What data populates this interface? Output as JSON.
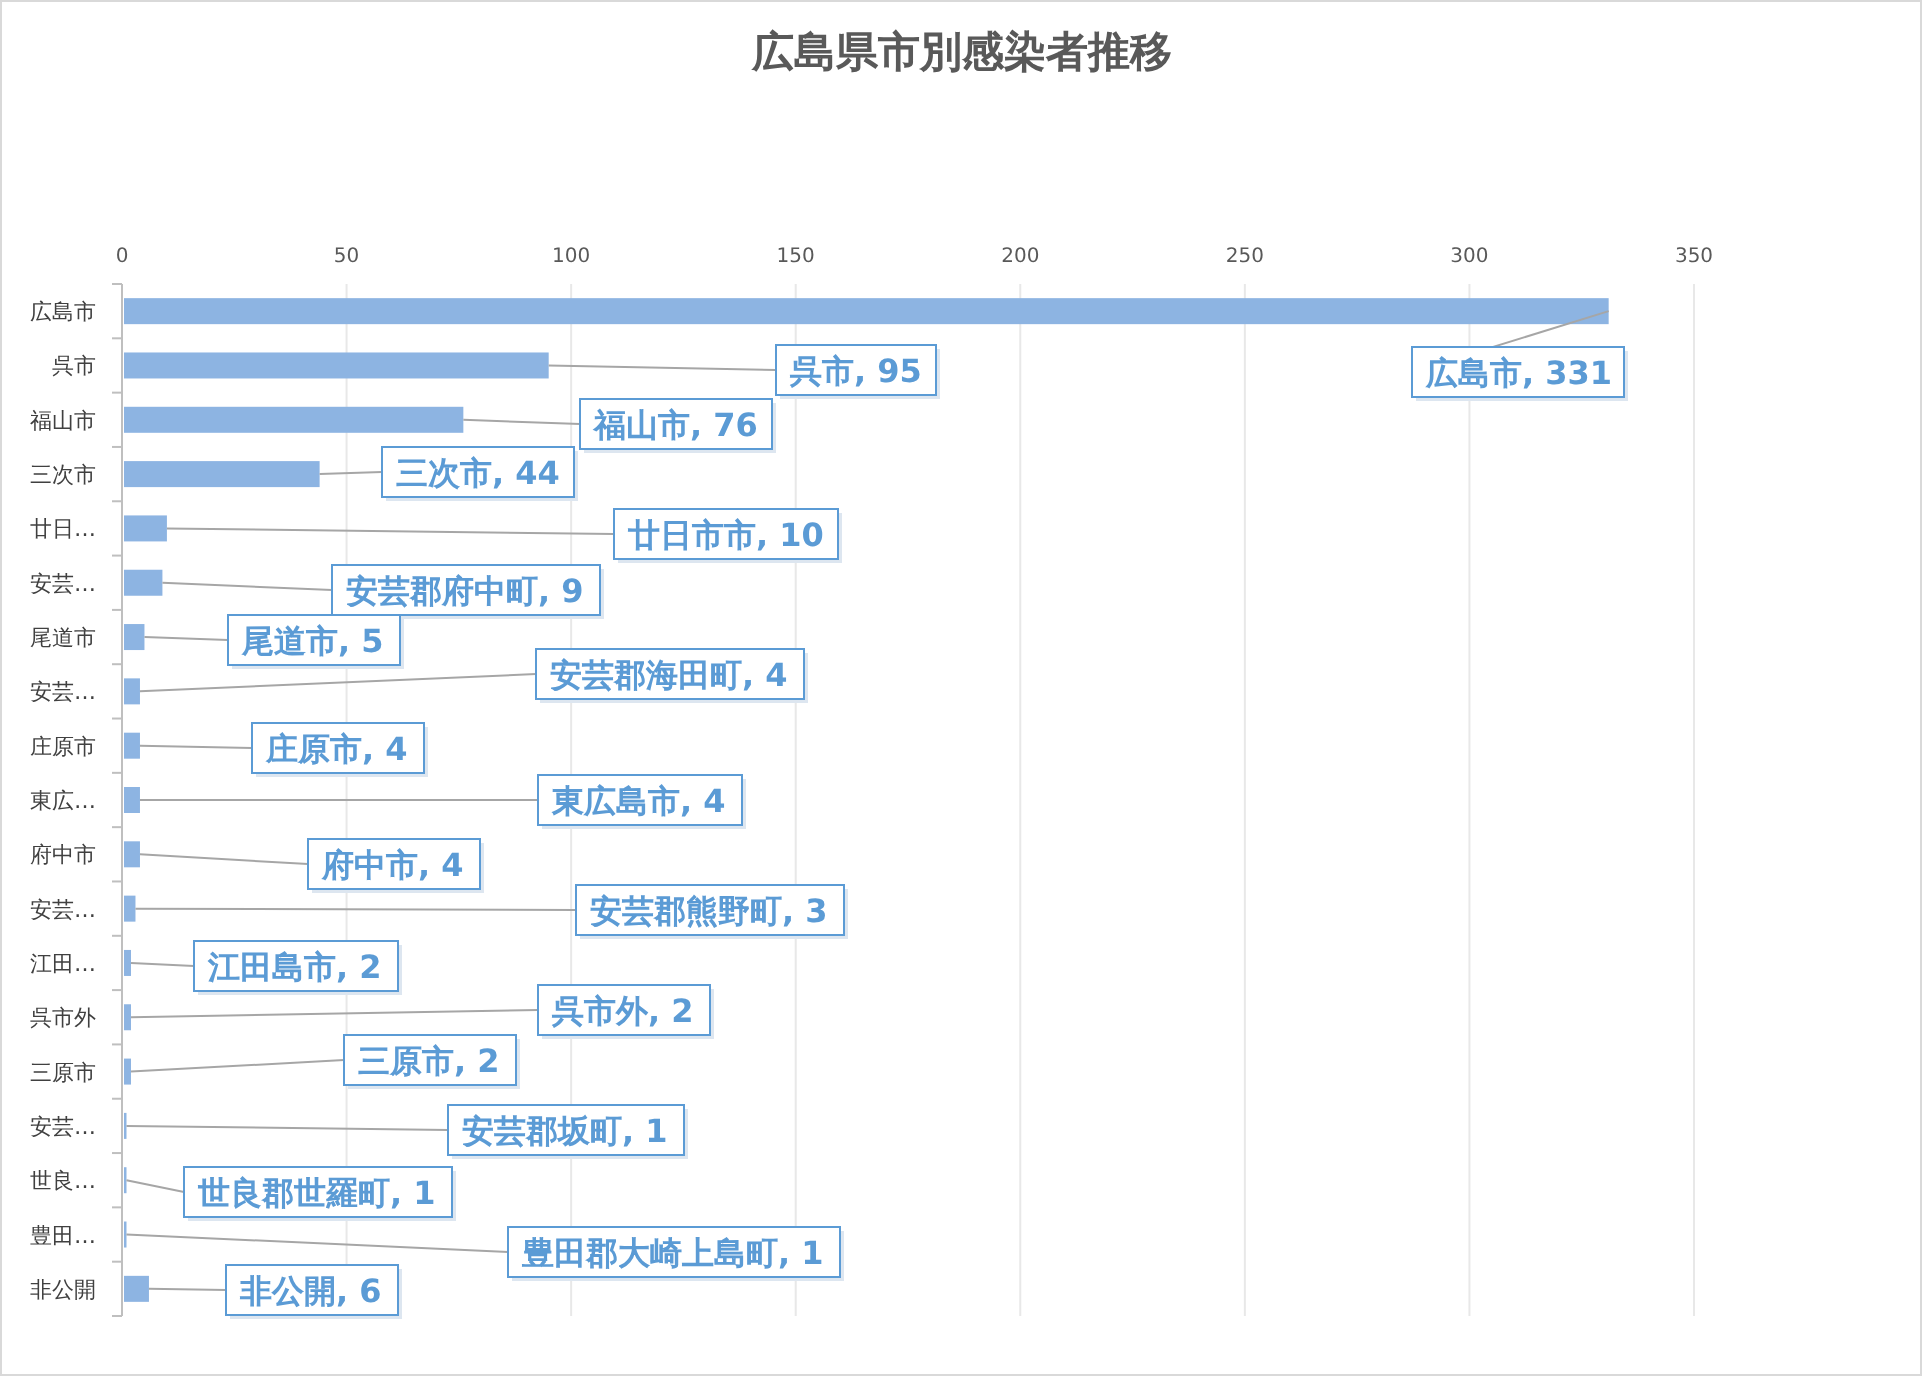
{
  "chart": {
    "chart_data": {
      "type": "bar",
      "orientation": "horizontal",
      "title": "広島県市別感染者推移",
      "categories": [
        "広島市",
        "呉市",
        "福山市",
        "三次市",
        "廿日…",
        "安芸…",
        "尾道市",
        "安芸…",
        "庄原市",
        "東広…",
        "府中市",
        "安芸…",
        "江田…",
        "呉市外",
        "三原市",
        "安芸…",
        "世良…",
        "豊田…",
        "非公開"
      ],
      "values": [
        331,
        95,
        76,
        44,
        10,
        9,
        5,
        4,
        4,
        4,
        4,
        3,
        2,
        2,
        2,
        1,
        1,
        1,
        6
      ],
      "xlim": [
        0,
        350
      ],
      "grid": true,
      "xticks": [
        0,
        50,
        100,
        150,
        200,
        250,
        300,
        350
      ],
      "value_labels": [
        "広島市, 331",
        "呉市, 95",
        "福山市, 76",
        "三次市, 44",
        "廿日市市, 10",
        "安芸郡府中町, 9",
        "尾道市, 5",
        "安芸郡海田町, 4",
        "庄原市, 4",
        "東広島市, 4",
        "府中市, 4",
        "安芸郡熊野町, 3",
        "江田島市, 2",
        "呉市外, 2",
        "三原市, 2",
        "安芸郡坂町, 1",
        "世良郡世羅町, 1",
        "豊田郡大崎上島町, 1",
        "非公開, 6"
      ]
    }
  }
}
